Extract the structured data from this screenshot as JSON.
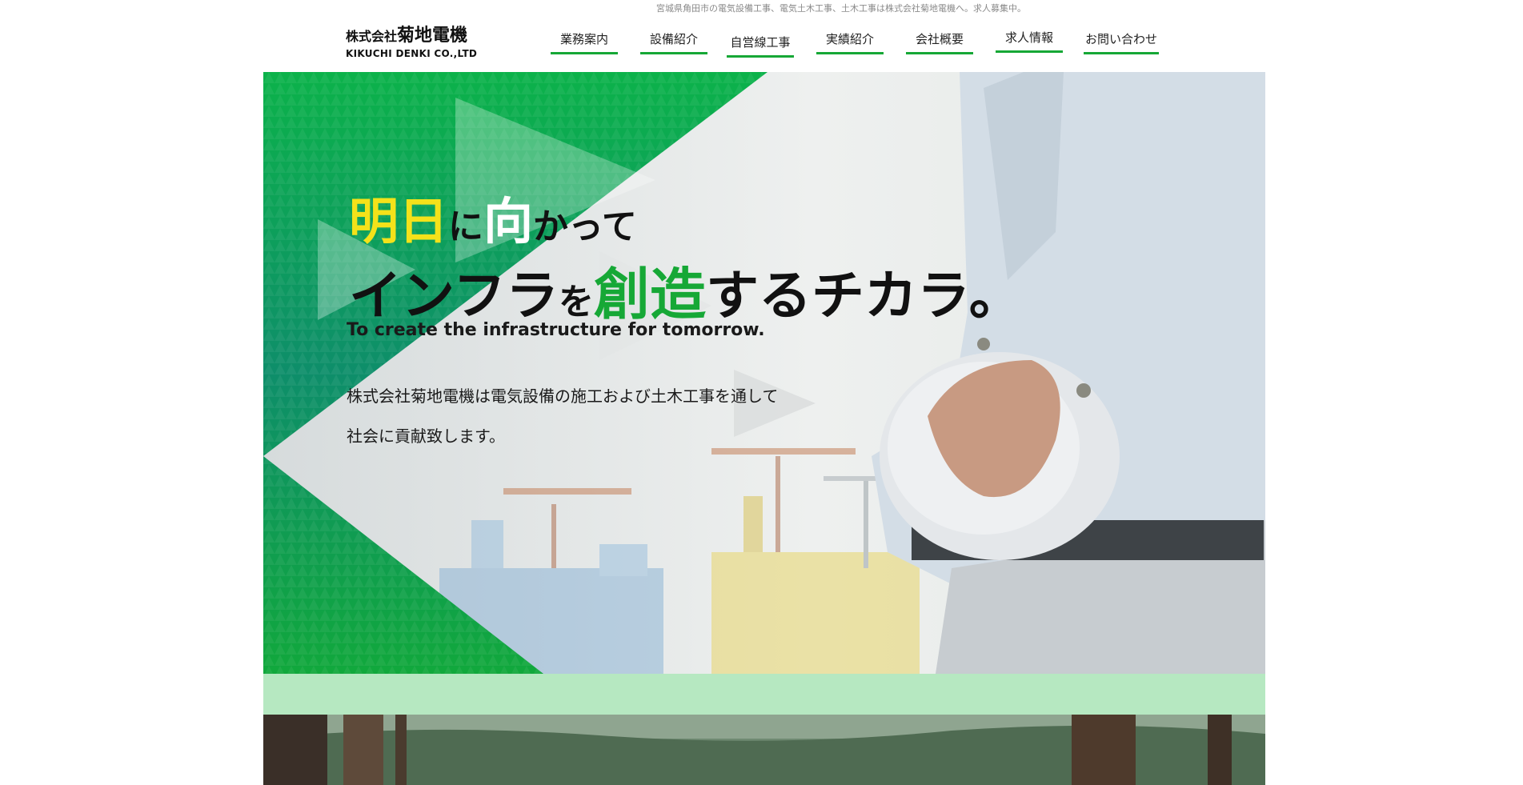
{
  "header": {
    "tagline": "宮城県角田市の電気設備工事、電気土木工事、土木工事は株式会社菊地電機へ。求人募集中。",
    "logo": {
      "prefix": "株式会社",
      "name": "菊地電機",
      "en": "KIKUCHI DENKI CO.,LTD"
    }
  },
  "nav": {
    "items": [
      {
        "label": "業務案内"
      },
      {
        "label": "設備紹介"
      },
      {
        "label": "自営線工事"
      },
      {
        "label": "実績紹介"
      },
      {
        "label": "会社概要"
      },
      {
        "label": "求人情報"
      },
      {
        "label": "お問い合わせ"
      }
    ],
    "accent_color": "#16a836"
  },
  "hero": {
    "line1": {
      "a": "明日",
      "b": "に",
      "c": "向",
      "d": "かって"
    },
    "line2": {
      "a": "インフラ",
      "b": "を",
      "c": "創造",
      "d": "するチカラ。"
    },
    "english": "To create the infrastructure for tomorrow.",
    "description": [
      "株式会社菊地電機は電気設備の施工および土木工事を通して",
      "社会に貢献致します。"
    ],
    "colors": {
      "green": "#16a836",
      "yellow": "#f4e21a",
      "band": "#b6e8c1"
    }
  }
}
